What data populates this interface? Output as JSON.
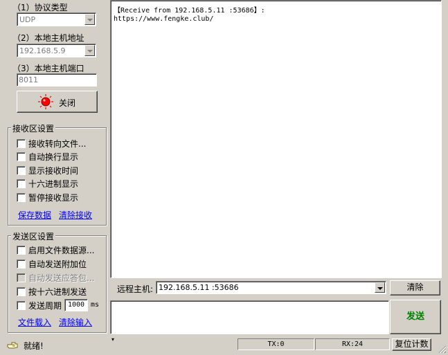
{
  "settings": {
    "protocol_label": "（1）协议类型",
    "protocol_value": "UDP",
    "host_label": "（2）本地主机地址",
    "host_value": "192.168.5.9",
    "port_label": "（3）本地主机端口",
    "port_value": "8011",
    "close_button": "关闭"
  },
  "receive_area": {
    "title": "接收区设置",
    "options": [
      {
        "label": "接收转向文件...",
        "checked": false,
        "enabled": true
      },
      {
        "label": "自动换行显示",
        "checked": false,
        "enabled": true
      },
      {
        "label": "显示接收时间",
        "checked": false,
        "enabled": true
      },
      {
        "label": "十六进制显示",
        "checked": false,
        "enabled": true
      },
      {
        "label": "暂停接收显示",
        "checked": false,
        "enabled": true
      }
    ],
    "save_link": "保存数据",
    "clear_link": "清除接收"
  },
  "send_area": {
    "title": "发送区设置",
    "options": [
      {
        "label": "启用文件数据源...",
        "checked": false,
        "enabled": true
      },
      {
        "label": "自动发送附加位",
        "checked": false,
        "enabled": true
      },
      {
        "label": "自动发送应答包...",
        "checked": false,
        "enabled": false
      },
      {
        "label": "按十六进制发送",
        "checked": false,
        "enabled": true
      },
      {
        "label": "发送周期",
        "checked": false,
        "enabled": true
      }
    ],
    "period_value": "1000",
    "period_unit": "ms",
    "load_link": "文件载入",
    "clear_link": "清除输入"
  },
  "receive_text": {
    "line1": "【Receive from 192.168.5.11 :53686】:",
    "line2": "https://www.fengke.club/"
  },
  "remote": {
    "label": "远程主机:",
    "value": "192.168.5.11 :53686",
    "clear_button": "清除"
  },
  "send": {
    "input_value": "",
    "send_button": "发送",
    "send_color": "#008000"
  },
  "status": {
    "text": "就绪!",
    "tx": "TX:0",
    "rx": "RX:24",
    "reset_button": "复位计数"
  },
  "colors": {
    "close_indicator": "#ff0000",
    "link": "#0000ff"
  }
}
